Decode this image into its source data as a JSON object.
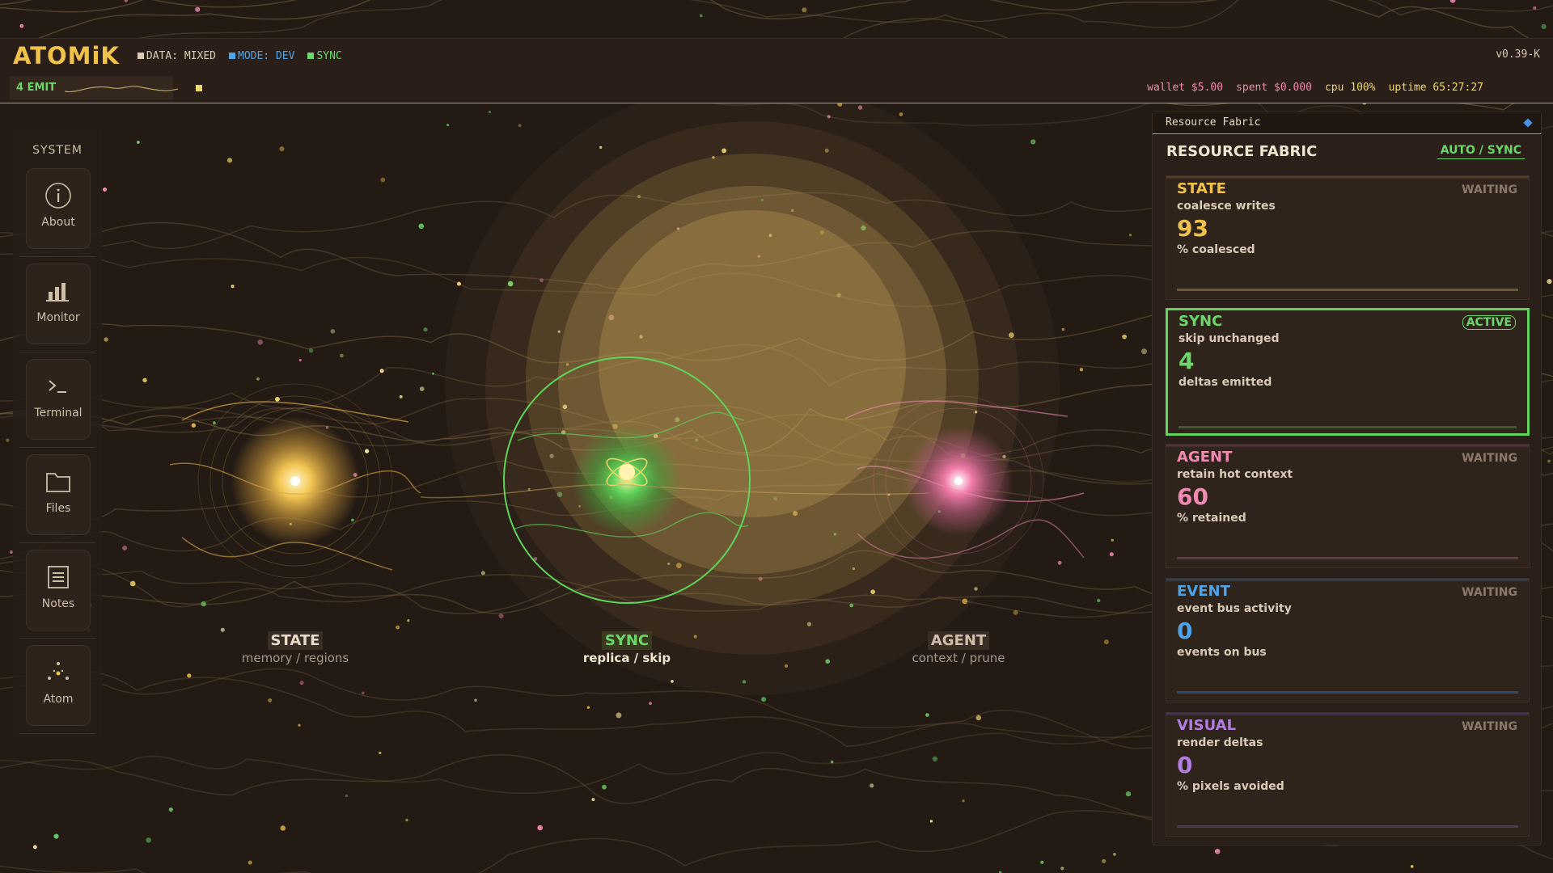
{
  "app": {
    "logo": "ATOMiK",
    "tags": [
      {
        "label": "DATA: MIXED",
        "color": "#d9cbb5"
      },
      {
        "label": "MODE: DEV",
        "color": "#4fa3e8"
      },
      {
        "label": "SYNC",
        "color": "#6dd66a"
      }
    ],
    "version": "v0.39-K"
  },
  "statbar": {
    "emit_label": "4 EMIT",
    "wallet": "wallet $5.00",
    "spent": "spent $0.000",
    "cpu": "cpu 100%",
    "uptime": "uptime 65:27:27"
  },
  "sidebar": {
    "title": "SYSTEM",
    "items": [
      {
        "label": "About",
        "icon": "info-icon"
      },
      {
        "label": "Monitor",
        "icon": "bar-chart-icon"
      },
      {
        "label": "Terminal",
        "icon": "terminal-icon"
      },
      {
        "label": "Files",
        "icon": "folder-icon"
      },
      {
        "label": "Notes",
        "icon": "notes-icon"
      },
      {
        "label": "Atom",
        "icon": "atom-icon"
      }
    ]
  },
  "scene": {
    "nodes": [
      {
        "name": "STATE",
        "sub": "memory / regions",
        "color": "#f1c24a"
      },
      {
        "name": "SYNC",
        "sub": "replica / skip",
        "color": "#6dd66a"
      },
      {
        "name": "AGENT",
        "sub": "context / prune",
        "color": "#f08ab0"
      }
    ]
  },
  "panel": {
    "header": "Resource Fabric",
    "title": "RESOURCE FABRIC",
    "mode_button": "AUTO / SYNC",
    "cards": [
      {
        "title": "STATE",
        "status": "WAITING",
        "desc": "coalesce writes",
        "value": "93",
        "unit": "% coalesced",
        "color": "#f1c24a"
      },
      {
        "title": "SYNC",
        "status": "ACTIVE",
        "desc": "skip unchanged",
        "value": "4",
        "unit": "deltas emitted",
        "color": "#6dd66a"
      },
      {
        "title": "AGENT",
        "status": "WAITING",
        "desc": "retain hot context",
        "value": "60",
        "unit": "% retained",
        "color": "#f08ab0"
      },
      {
        "title": "EVENT",
        "status": "WAITING",
        "desc": "event bus activity",
        "value": "0",
        "unit": "events on bus",
        "color": "#4fa3e8"
      },
      {
        "title": "VISUAL",
        "status": "WAITING",
        "desc": "render deltas",
        "value": "0",
        "unit": "% pixels avoided",
        "color": "#b27ee0"
      }
    ]
  }
}
